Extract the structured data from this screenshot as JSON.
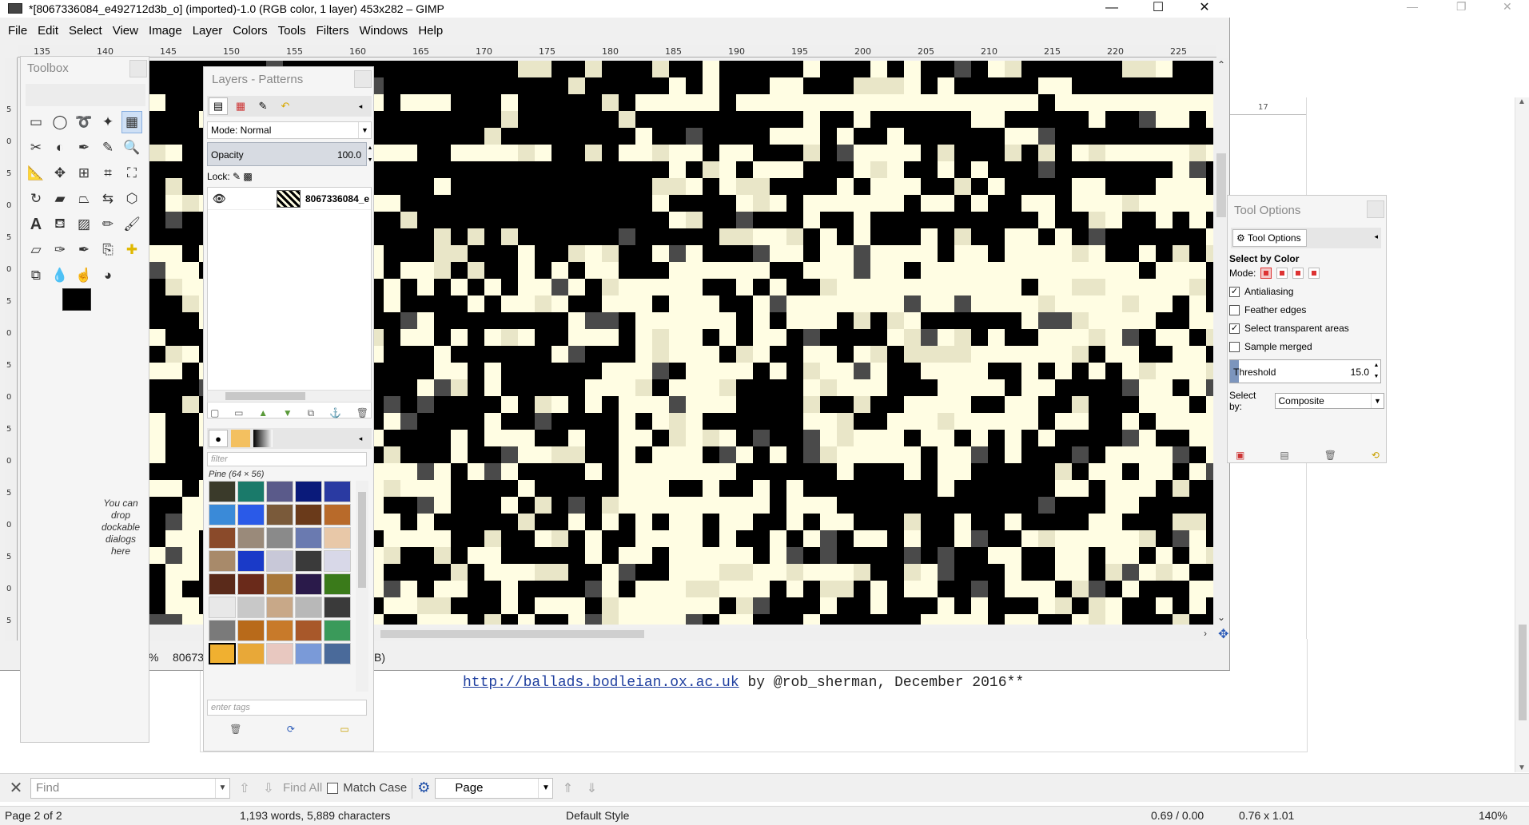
{
  "writer": {
    "text_line_link": "http://ballads.bodleian.ox.ac.uk",
    "text_line_rest": " by @rob_sherman, December 2016**",
    "ruler_value": "17",
    "find": {
      "close": "✕",
      "placeholder": "Find",
      "find_all": "Find All",
      "match_case": "Match Case",
      "scope": "Page"
    },
    "status": {
      "page": "Page 2 of 2",
      "words": "1,193 words, 5,889 characters",
      "style": "Default Style",
      "position": "0.69 / 0.00",
      "size": "0.76 x 1.01",
      "zoom": "140%"
    }
  },
  "gimp": {
    "title": "*[8067336084_e492712d3b_o] (imported)-1.0 (RGB color, 1 layer) 453x282 – GIMP",
    "window_buttons": {
      "minimize": "—",
      "maximize": "☐",
      "close": "✕"
    },
    "menu": [
      {
        "label": "File"
      },
      {
        "label": "Edit"
      },
      {
        "label": "Select"
      },
      {
        "label": "View"
      },
      {
        "label": "Image"
      },
      {
        "label": "Layer"
      },
      {
        "label": "Colors"
      },
      {
        "label": "Tools"
      },
      {
        "label": "Filters"
      },
      {
        "label": "Windows"
      },
      {
        "label": "Help"
      }
    ],
    "hruler_ticks": [
      "135",
      "140",
      "145",
      "150",
      "155",
      "160",
      "165",
      "170",
      "175",
      "180",
      "185",
      "190",
      "195",
      "200",
      "205",
      "210",
      "215",
      "220",
      "225"
    ],
    "vruler_ticks": [
      "5",
      "0",
      "5",
      "0",
      "5",
      "0",
      "5",
      "0",
      "5",
      "0",
      "5",
      "0",
      "5",
      "0",
      "5",
      "0",
      "5"
    ],
    "statusbar": {
      "zoom": "%",
      "name": "80673",
      "suffix": "B)"
    },
    "canvas_colors": {
      "ink": "#000000",
      "paper": "#fffde3",
      "gray": "#4a4a4a",
      "light": "#e9e6c8"
    }
  },
  "toolbox": {
    "title": "Toolbox",
    "tools": [
      "rect-select",
      "ellipse-select",
      "free-select",
      "fuzzy-select",
      "select-by-color",
      "scissors",
      "foreground-select",
      "paths",
      "color-picker",
      "zoom",
      "measure",
      "move",
      "align",
      "crop",
      "unified-transform",
      "rotate",
      "shear",
      "perspective",
      "flip",
      "cage",
      "text",
      "bucket-fill",
      "gradient",
      "pencil",
      "paintbrush",
      "eraser",
      "airbrush",
      "ink",
      "clone",
      "heal",
      "perspective-clone",
      "blur",
      "smudge",
      "dodge"
    ],
    "drop_hint": "You can drop dockable dialogs here"
  },
  "layers": {
    "title": "Layers - Patterns",
    "mode_label": "Mode: Normal",
    "opacity_label": "Opacity",
    "opacity_value": "100.0",
    "lock_label": "Lock:",
    "layer_name": "8067336084_e",
    "filter_placeholder": "filter",
    "pattern_caption": "Pine (64 × 56)",
    "tags_placeholder": "enter tags",
    "pattern_colors": [
      "#3a3a2a",
      "#1a7a6a",
      "#5a5a8a",
      "#0a1a7a",
      "#2a3aa2",
      "#3a8ad8",
      "#2a5ae8",
      "#7a5a3a",
      "#6a3a1a",
      "#b86a2a",
      "#8a4a2a",
      "#9a8a7a",
      "#8a8a8a",
      "#6a7ab0",
      "#e8c8a8",
      "#a88a6a",
      "#1a3ac8",
      "#c8c8d8",
      "#3a3a3a",
      "#d8d8e8",
      "#5a2a1a",
      "#6a2a1a",
      "#a8783a",
      "#2a1a4a",
      "#3a7a1a",
      "#e8e8e8",
      "#c8c8c8",
      "#c8a888",
      "#b8b8b8",
      "#3a3a3a",
      "#7a7a7a",
      "#b86a1a",
      "#c87a2a",
      "#a8582a",
      "#3a9a5a",
      "#f0b030",
      "#e8a838",
      "#e8c8c0",
      "#7a9ad8",
      "#4a6a9a"
    ]
  },
  "tool_options": {
    "title": "Tool Options",
    "tab_label": "Tool Options",
    "heading": "Select by Color",
    "mode_label": "Mode:",
    "options": [
      {
        "label": "Antialiasing",
        "checked": true
      },
      {
        "label": "Feather edges",
        "checked": false
      },
      {
        "label": "Select transparent areas",
        "checked": true
      },
      {
        "label": "Sample merged",
        "checked": false
      }
    ],
    "threshold_label": "Threshold",
    "threshold_value": "15.0",
    "threshold_fraction": 0.06,
    "select_by_label": "Select by:",
    "select_by_value": "Composite"
  }
}
